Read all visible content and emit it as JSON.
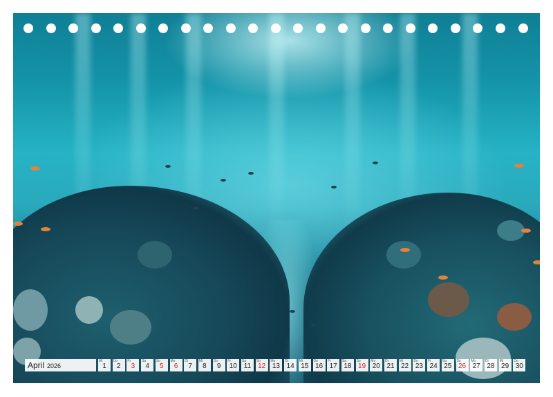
{
  "calendar": {
    "month": "April",
    "year": "2026",
    "days": [
      {
        "wd": "Mi",
        "num": "1",
        "red": false
      },
      {
        "wd": "Do",
        "num": "2",
        "red": false
      },
      {
        "wd": "Fr",
        "num": "3",
        "red": true
      },
      {
        "wd": "Sa",
        "num": "4",
        "red": false
      },
      {
        "wd": "So",
        "num": "5",
        "red": true
      },
      {
        "wd": "Mo",
        "num": "6",
        "red": true
      },
      {
        "wd": "Di",
        "num": "7",
        "red": false
      },
      {
        "wd": "Mi",
        "num": "8",
        "red": false
      },
      {
        "wd": "Do",
        "num": "9",
        "red": false
      },
      {
        "wd": "Fr",
        "num": "10",
        "red": false
      },
      {
        "wd": "Sa",
        "num": "11",
        "red": false
      },
      {
        "wd": "So",
        "num": "12",
        "red": true
      },
      {
        "wd": "Mo",
        "num": "13",
        "red": false
      },
      {
        "wd": "Di",
        "num": "14",
        "red": false
      },
      {
        "wd": "Mi",
        "num": "15",
        "red": false
      },
      {
        "wd": "Do",
        "num": "16",
        "red": false
      },
      {
        "wd": "Fr",
        "num": "17",
        "red": false
      },
      {
        "wd": "Sa",
        "num": "18",
        "red": false
      },
      {
        "wd": "So",
        "num": "19",
        "red": true
      },
      {
        "wd": "Mo",
        "num": "20",
        "red": false
      },
      {
        "wd": "Di",
        "num": "21",
        "red": false
      },
      {
        "wd": "Mi",
        "num": "22",
        "red": false
      },
      {
        "wd": "Do",
        "num": "23",
        "red": false
      },
      {
        "wd": "Fr",
        "num": "24",
        "red": false
      },
      {
        "wd": "Sa",
        "num": "25",
        "red": false
      },
      {
        "wd": "So",
        "num": "26",
        "red": true
      },
      {
        "wd": "Mo",
        "num": "27",
        "red": false
      },
      {
        "wd": "Di",
        "num": "28",
        "red": false
      },
      {
        "wd": "Mi",
        "num": "29",
        "red": false
      },
      {
        "wd": "Do",
        "num": "30",
        "red": false
      }
    ]
  },
  "colors": {
    "holiday": "#cc2b2b",
    "water_light": "#26b3c5",
    "water_deep": "#0d4f66"
  }
}
